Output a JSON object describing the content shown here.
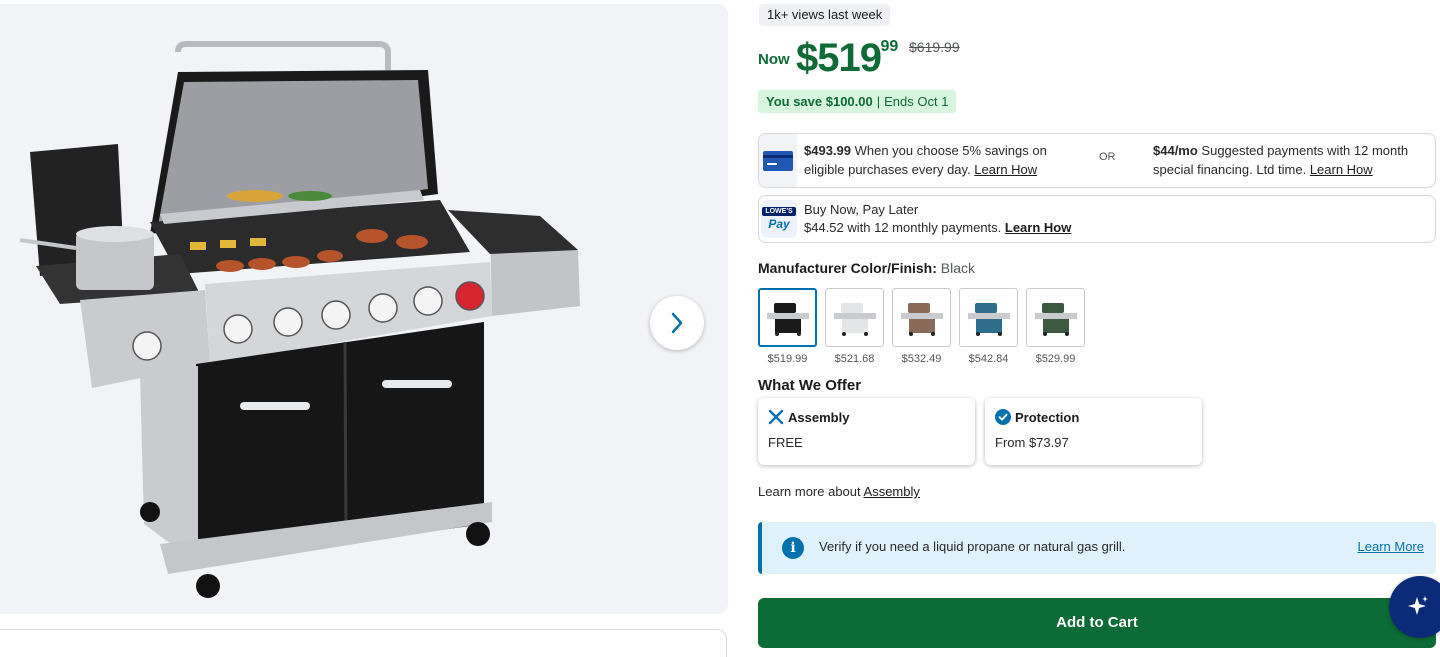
{
  "views_badge": "1k+ views last week",
  "price": {
    "now_label": "Now",
    "dollars": "$519",
    "cents": ".99",
    "was": "$619.99",
    "savings": "You save $100.00",
    "separator": "|",
    "ends": "Ends Oct 1"
  },
  "finance": {
    "left_amount": "$493.99",
    "left_text": " When you choose 5% savings on eligible purchases every day. ",
    "left_link": "Learn How",
    "or": "OR",
    "right_amount": "$44/mo",
    "right_text": " Suggested payments with 12 month special financing. Ltd time. ",
    "right_link": "Learn How"
  },
  "bnpl": {
    "icon_top": "LOWE'S",
    "icon_bottom": "Pay",
    "line1": "Buy Now, Pay Later",
    "line2": "$44.52 with 12 monthly payments. ",
    "link": "Learn How"
  },
  "color_finish": {
    "label": "Manufacturer Color/Finish:",
    "value": "Black",
    "swatches": [
      {
        "price": "$519.99",
        "color": "#1a1a1a",
        "selected": true
      },
      {
        "price": "$521.68",
        "color": "#e4e5e7",
        "selected": false
      },
      {
        "price": "$532.49",
        "color": "#8a6a58",
        "selected": false
      },
      {
        "price": "$542.84",
        "color": "#2f6d8c",
        "selected": false
      },
      {
        "price": "$529.99",
        "color": "#3c5a40",
        "selected": false
      }
    ]
  },
  "what_we_offer": {
    "heading": "What We Offer",
    "assembly_title": "Assembly",
    "assembly_sub": "FREE",
    "protection_title": "Protection",
    "protection_sub": "From $73.97"
  },
  "learn_more": {
    "text": "Learn more about ",
    "link": "Assembly"
  },
  "info": {
    "message": "Verify if you need a liquid propane or natural gas grill.",
    "link": "Learn More"
  },
  "add_to_cart": "Add to Cart",
  "colors": {
    "green": "#0d6b35",
    "blue": "#0471af",
    "navy": "#012169"
  }
}
